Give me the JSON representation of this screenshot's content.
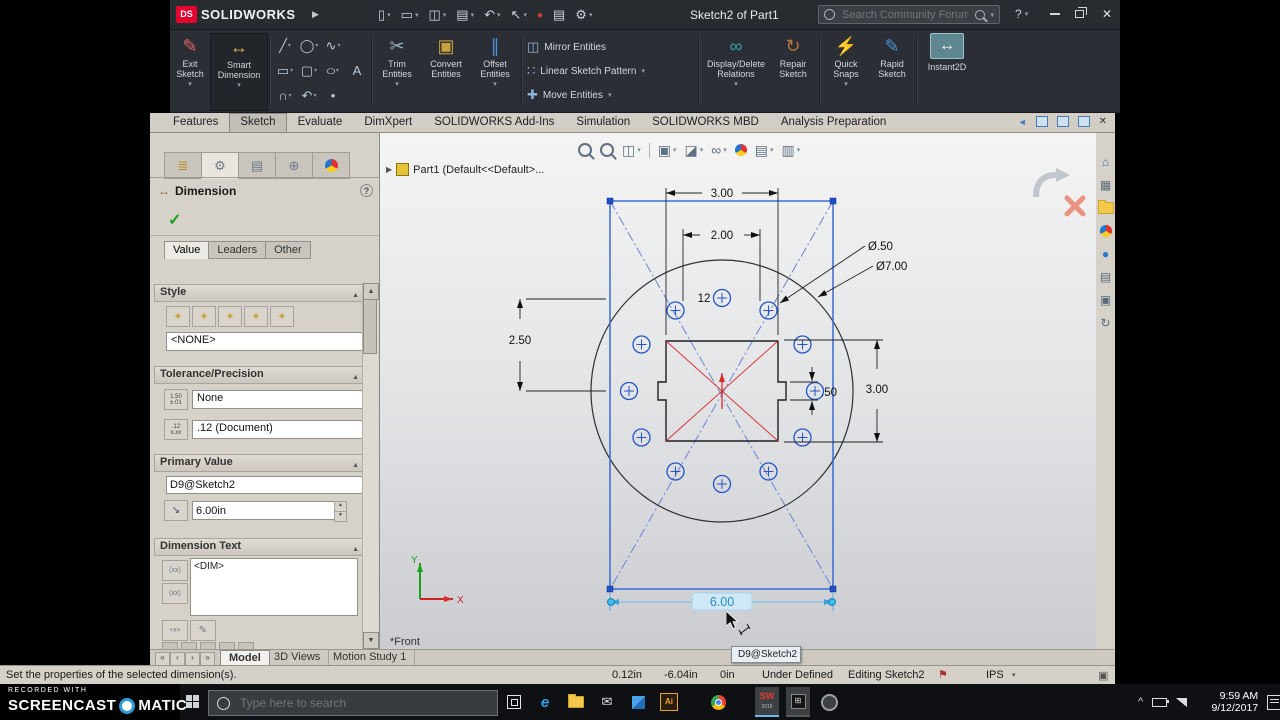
{
  "titlebar": {
    "logo_ds": "DS",
    "logo_text": "SOLIDWORKS",
    "title": "Sketch2 of Part1",
    "search_placeholder": "Search Community Forum",
    "help": "?"
  },
  "ribbon": {
    "exit_sketch": "Exit Sketch",
    "smart_dimension": "Smart Dimension",
    "trim": "Trim Entities",
    "convert": "Convert Entities",
    "offset": "Offset Entities",
    "mirror": "Mirror Entities",
    "linear_pattern": "Linear Sketch Pattern",
    "move": "Move Entities",
    "display_delete": "Display/Delete Relations",
    "repair": "Repair Sketch",
    "quick_snaps": "Quick Snaps",
    "rapid_sketch": "Rapid Sketch",
    "instant2d": "Instant2D"
  },
  "command_tabs": [
    "Features",
    "Sketch",
    "Evaluate",
    "DimXpert",
    "SOLIDWORKS Add-Ins",
    "Simulation",
    "SOLIDWORKS MBD",
    "Analysis Preparation"
  ],
  "panel": {
    "title": "Dimension",
    "help": "?",
    "tabs": [
      "Value",
      "Leaders",
      "Other"
    ],
    "style_label": "Style",
    "style_value": "<NONE>",
    "tolerance_label": "Tolerance/Precision",
    "tolerance_value": "None",
    "precision_value": ".12 (Document)",
    "primary_label": "Primary Value",
    "primary_name": "D9@Sketch2",
    "primary_value": "6.00in",
    "dimtext_label": "Dimension Text",
    "dimtext_value": "<DIM>"
  },
  "viewport": {
    "tree_root": "Part1  (Default<<Default>...",
    "view_label": "*Front",
    "tooltip": "D9@Sketch2",
    "axis_x": "X",
    "axis_y": "Y",
    "dims": {
      "top_width": "3.00",
      "hole_spacing": "2.00",
      "hole_dia": "Ø.50",
      "circle_dia": "Ø7.00",
      "count": "12",
      "left_height": "2.50",
      "right_height": "3.00",
      "notch": ".50",
      "overall_width": "6.00"
    }
  },
  "bottom_tabs": [
    "Model",
    "3D Views",
    "Motion Study 1"
  ],
  "status": {
    "message": "Set the properties of the selected dimension(s).",
    "x": "0.12in",
    "y": "-6.04in",
    "z": "0in",
    "state": "Under Defined",
    "editing": "Editing Sketch2",
    "units": "IPS"
  },
  "watermark": {
    "line1": "RECORDED WITH",
    "brand_left": "SCREENCAST",
    "brand_right": "MATIC"
  },
  "taskbar": {
    "search_placeholder": "Type here to search",
    "time": "9:59 AM",
    "date": "9/12/2017"
  }
}
